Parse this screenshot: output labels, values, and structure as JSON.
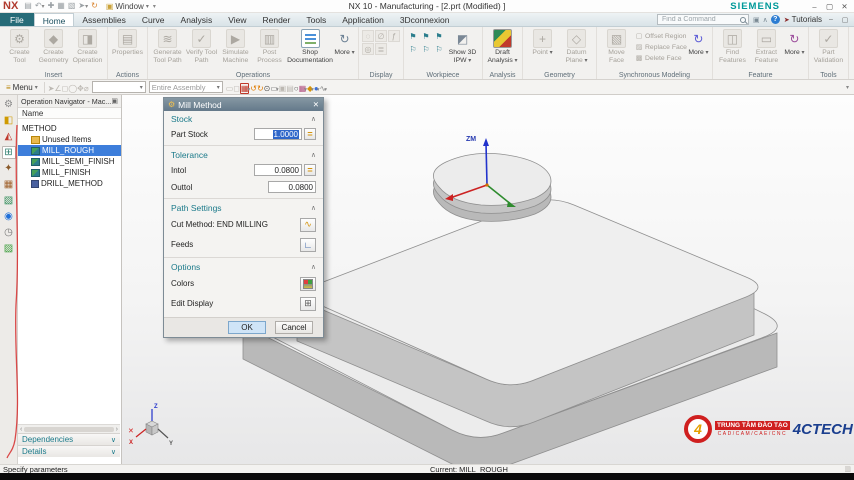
{
  "window": {
    "logo": "NX",
    "title": "NX 10 - Manufacturing - [2.prt (Modified) ]",
    "brand": "SIEMENS",
    "window_menu": "Window",
    "quick_access": [
      "save",
      "undo",
      "paste",
      "copy",
      "clipboard",
      "selection",
      "repeat-command"
    ]
  },
  "command": {
    "placeholder": "Find a Command",
    "tutorials": "Tutorials",
    "icons": [
      "screens",
      "minimize-ribbon",
      "help"
    ]
  },
  "tabs": [
    {
      "label": "File",
      "kind": "file"
    },
    {
      "label": "Home",
      "active": true
    },
    {
      "label": "Assemblies"
    },
    {
      "label": "Curve"
    },
    {
      "label": "Analysis"
    },
    {
      "label": "View"
    },
    {
      "label": "Render"
    },
    {
      "label": "Tools"
    },
    {
      "label": "Application"
    },
    {
      "label": "3Dconnexion"
    }
  ],
  "ribbon": {
    "groups": [
      {
        "name": "Insert",
        "items": [
          {
            "label": "Create Tool",
            "icon": "create-tool",
            "enabled": false
          },
          {
            "label": "Create Geometry",
            "icon": "create-geometry",
            "enabled": false
          },
          {
            "label": "Create Operation",
            "icon": "create-operation",
            "enabled": false
          }
        ]
      },
      {
        "name": "Actions",
        "items": [
          {
            "label": "Properties",
            "icon": "properties",
            "enabled": false
          }
        ]
      },
      {
        "name": "Operations",
        "items": [
          {
            "label": "Generate Tool Path",
            "icon": "generate-tool-path",
            "enabled": false
          },
          {
            "label": "Verify Tool Path",
            "icon": "verify-tool-path",
            "enabled": false
          },
          {
            "label": "Simulate Machine",
            "icon": "simulate-machine",
            "enabled": false
          },
          {
            "label": "Post Process",
            "icon": "post-process",
            "enabled": false
          },
          {
            "label": "Shop Documentation",
            "icon": "shop-documentation",
            "enabled": true,
            "wide": true
          },
          {
            "label": "More",
            "icon": "more",
            "enabled": true,
            "dropdown": true,
            "narrow": true,
            "color": "#6a7f93"
          }
        ]
      },
      {
        "name": "Display",
        "items": [
          {
            "kind": "small",
            "icon": "object-display",
            "enabled": false
          },
          {
            "kind": "small",
            "icon": "show-hide",
            "enabled": false
          },
          {
            "kind": "small",
            "icon": "immediate-hide",
            "enabled": false
          },
          {
            "kind": "small",
            "icon": "layer-settings",
            "enabled": false
          },
          {
            "kind": "small",
            "icon": "curve-display",
            "enabled": false
          }
        ]
      },
      {
        "name": "Workpiece",
        "items": [
          {
            "kind": "small",
            "icon": "show-tool-path",
            "enabled": true,
            "color": "#2a7d8c"
          },
          {
            "kind": "small",
            "icon": "hide-tool-path",
            "enabled": true,
            "color": "#2a7d8c"
          },
          {
            "kind": "small",
            "icon": "replay-tool-path",
            "enabled": true,
            "color": "#2a7d8c"
          },
          {
            "kind": "small",
            "icon": "list-tool-path",
            "enabled": true,
            "color": "#2a7d8c"
          },
          {
            "kind": "small",
            "icon": "gouge-check",
            "enabled": true,
            "color": "#2a7d8c"
          },
          {
            "kind": "small",
            "icon": "tool-path-report",
            "enabled": true,
            "color": "#2a7d8c"
          },
          {
            "label": "Show 3D IPW",
            "icon": "show-3d-ipw",
            "enabled": true,
            "dropdown": true,
            "color": "#7a8795"
          }
        ]
      },
      {
        "name": "Analysis",
        "items": [
          {
            "label": "Draft Analysis",
            "icon": "draft-analysis",
            "enabled": true,
            "dropdown": true
          }
        ]
      },
      {
        "name": "Geometry",
        "items": [
          {
            "label": "Point",
            "icon": "point",
            "enabled": false,
            "dropdown": true
          },
          {
            "label": "Datum Plane",
            "icon": "datum-plane",
            "enabled": false,
            "dropdown": true
          }
        ]
      },
      {
        "name": "Synchronous Modeling",
        "items": [
          {
            "label": "Move Face",
            "icon": "move-face",
            "enabled": false
          },
          {
            "kind": "smalltext",
            "label": "Offset Region",
            "icon": "offset-region",
            "enabled": false
          },
          {
            "kind": "smalltext",
            "label": "Replace Face",
            "icon": "replace-face",
            "enabled": false
          },
          {
            "kind": "smalltext",
            "label": "Delete Face",
            "icon": "delete-face",
            "enabled": false
          },
          {
            "label": "More",
            "icon": "more",
            "enabled": true,
            "dropdown": true,
            "narrow": true,
            "color": "#5b5bd6"
          }
        ]
      },
      {
        "name": "Feature",
        "items": [
          {
            "label": "Find Features",
            "icon": "find-features",
            "enabled": false
          },
          {
            "label": "Extract Feature",
            "icon": "extract-feature",
            "enabled": false
          },
          {
            "label": "More",
            "icon": "more",
            "enabled": true,
            "dropdown": true,
            "narrow": true,
            "color": "#9a4a9a"
          }
        ]
      },
      {
        "name": "Tools",
        "items": [
          {
            "label": "Part Validation",
            "icon": "part-validation",
            "enabled": false
          }
        ]
      }
    ]
  },
  "toolbar2": {
    "menu": "Menu",
    "scope_value": "Entire Assembly",
    "left_icons": [
      {
        "name": "selection-filter"
      },
      {
        "name": "snap-angle"
      },
      {
        "name": "select-top"
      },
      {
        "name": "select-region"
      },
      {
        "name": "pan-select"
      },
      {
        "name": "lasso"
      }
    ],
    "right_icons": [
      {
        "name": "work-layer"
      },
      {
        "name": "true-shading"
      },
      {
        "name": "snap-point",
        "enabled": true,
        "box": true,
        "dropdown": true,
        "color": "#c0392b"
      },
      {
        "name": "orient-up",
        "enabled": true,
        "color": "#e07b00"
      },
      {
        "name": "orient-down",
        "enabled": true,
        "color": "#e07b00"
      },
      {
        "name": "point-constructor",
        "enabled": true,
        "color": "#555555"
      },
      {
        "name": "rectangle-mode",
        "enabled": true,
        "dropdown": true,
        "color": "#777777"
      },
      {
        "sep": true
      },
      {
        "name": "cascade-windows"
      },
      {
        "name": "tile-windows"
      },
      {
        "name": "refresh-display",
        "enabled": true,
        "color": "#555555"
      },
      {
        "name": "fit-view",
        "enabled": true,
        "dropdown": true,
        "color": "#b05080"
      },
      {
        "name": "orient-wcs",
        "enabled": true,
        "dropdown": true,
        "color": "#d4930a"
      },
      {
        "name": "shaded-display",
        "enabled": true,
        "dropdown": true,
        "color": "#3a6fd8"
      },
      {
        "name": "render-style",
        "enabled": true,
        "dropdown": true,
        "color": "#888888"
      }
    ]
  },
  "resource_bar": [
    {
      "name": "roles",
      "glyph": "⚙",
      "color": "#8a8a8a"
    },
    {
      "name": "assembly-navigator",
      "glyph": "◧",
      "color": "#cf9a00"
    },
    {
      "name": "constraint-navigator",
      "glyph": "◭",
      "color": "#bf3a2e"
    },
    {
      "name": "operation-navigator",
      "glyph": "⊞",
      "color": "#2f7f6f",
      "active": true
    },
    {
      "name": "machining-wizard",
      "glyph": "✦",
      "color": "#8a5a2a"
    },
    {
      "name": "reuse-library",
      "glyph": "▦",
      "color": "#a0622d"
    },
    {
      "name": "hd3d-tools",
      "glyph": "▧",
      "color": "#2e8b57"
    },
    {
      "name": "web-browser",
      "glyph": "◉",
      "color": "#1e6fd9"
    },
    {
      "name": "history",
      "glyph": "◷",
      "color": "#777777"
    },
    {
      "name": "system-materials",
      "glyph": "▨",
      "color": "#3a9d3a"
    }
  ],
  "navigator": {
    "title": "Operation Navigator - Mac...",
    "column_header": "Name",
    "rows": [
      {
        "label": "METHOD",
        "indent": 0,
        "icon": "none"
      },
      {
        "label": "Unused Items",
        "indent": 1,
        "icon": "folder"
      },
      {
        "label": "MILL_ROUGH",
        "indent": 1,
        "icon": "mill",
        "selected": true
      },
      {
        "label": "MILL_SEMI_FINISH",
        "indent": 1,
        "icon": "mill"
      },
      {
        "label": "MILL_FINISH",
        "indent": 1,
        "icon": "mill"
      },
      {
        "label": "DRILL_METHOD",
        "indent": 1,
        "icon": "drill"
      }
    ],
    "panels": [
      {
        "label": "Dependencies"
      },
      {
        "label": "Details"
      }
    ]
  },
  "dialog": {
    "title": "Mill Method",
    "sections": [
      {
        "title": "Stock",
        "rows": [
          {
            "label": "Part Stock",
            "value": "1.0000",
            "value_selected": true,
            "button": "formula-toggle"
          }
        ]
      },
      {
        "title": "Tolerance",
        "rows": [
          {
            "label": "Intol",
            "value": "0.0800",
            "button": "formula-toggle"
          },
          {
            "label": "Outtol",
            "value": "0.0800"
          }
        ]
      },
      {
        "title": "Path Settings",
        "rows": [
          {
            "label": "Cut Method: END MILLING",
            "button": "cut-method"
          },
          {
            "label": "Feeds",
            "button": "feeds"
          }
        ]
      },
      {
        "title": "Options",
        "rows": [
          {
            "label": "Colors",
            "button": "colors"
          },
          {
            "label": "Edit Display",
            "button": "edit-display"
          }
        ]
      }
    ],
    "ok": "OK",
    "cancel": "Cancel"
  },
  "viewport": {
    "axis_label": "ZM",
    "triad_x": "X",
    "triad_y": "Y",
    "triad_z": "Z"
  },
  "logo": {
    "emblem": "4",
    "line1": "TRUNG TÂM ĐÀO TẠO",
    "line2": "CAD/CAM/CAE/CNC",
    "brand": "4CTECH"
  },
  "statusbar": {
    "message": "Specify parameters",
    "current": "Current: MILL_ROUGH"
  }
}
